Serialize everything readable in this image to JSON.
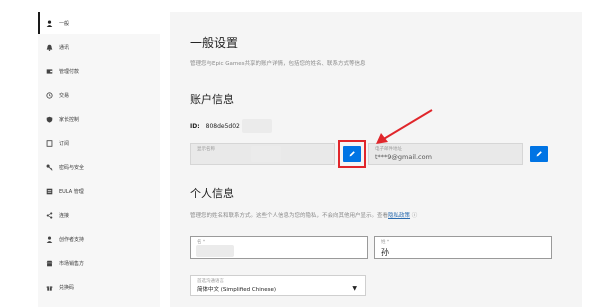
{
  "sidebar": {
    "items": [
      {
        "label": "一般",
        "icon": "user-icon",
        "active": true
      },
      {
        "label": "通讯",
        "icon": "bell-icon"
      },
      {
        "label": "管理付款",
        "icon": "wallet-icon"
      },
      {
        "label": "交易",
        "icon": "history-icon"
      },
      {
        "label": "家长控制",
        "icon": "shield-icon"
      },
      {
        "label": "订阅",
        "icon": "subscription-icon"
      },
      {
        "label": "密码与安全",
        "icon": "key-icon"
      },
      {
        "label": "EULA 管理",
        "icon": "eula-icon"
      },
      {
        "label": "连接",
        "icon": "share-icon"
      },
      {
        "label": "创作者支持",
        "icon": "creator-icon"
      },
      {
        "label": "市场销售方",
        "icon": "store-icon"
      },
      {
        "label": "兑换码",
        "icon": "gift-icon"
      }
    ]
  },
  "main": {
    "title": "一般设置",
    "description": "管理您与Epic Games共享的账户详情，包括您的姓名、联系方式等信息",
    "account_title": "账户信息",
    "id_label": "ID:",
    "id_value": "808de5d02",
    "display_name_label": "显示名称",
    "email_label": "电子邮件地址",
    "email_value": "t***9@gmail.com",
    "personal_title": "个人信息",
    "personal_desc": "管理您的姓名和联系方式。这些个人信息为您的隐私，不会向其他用户显示。查看",
    "privacy_link": "隐私政策",
    "first_name_label": "名 *",
    "last_name_label": "姓 *",
    "last_name_value": "孙",
    "language_label": "首选沟通语言",
    "language_value": "简体中文 (Simplified Chinese)"
  },
  "colors": {
    "accent": "#0074e4",
    "highlight": "#e0262b"
  }
}
